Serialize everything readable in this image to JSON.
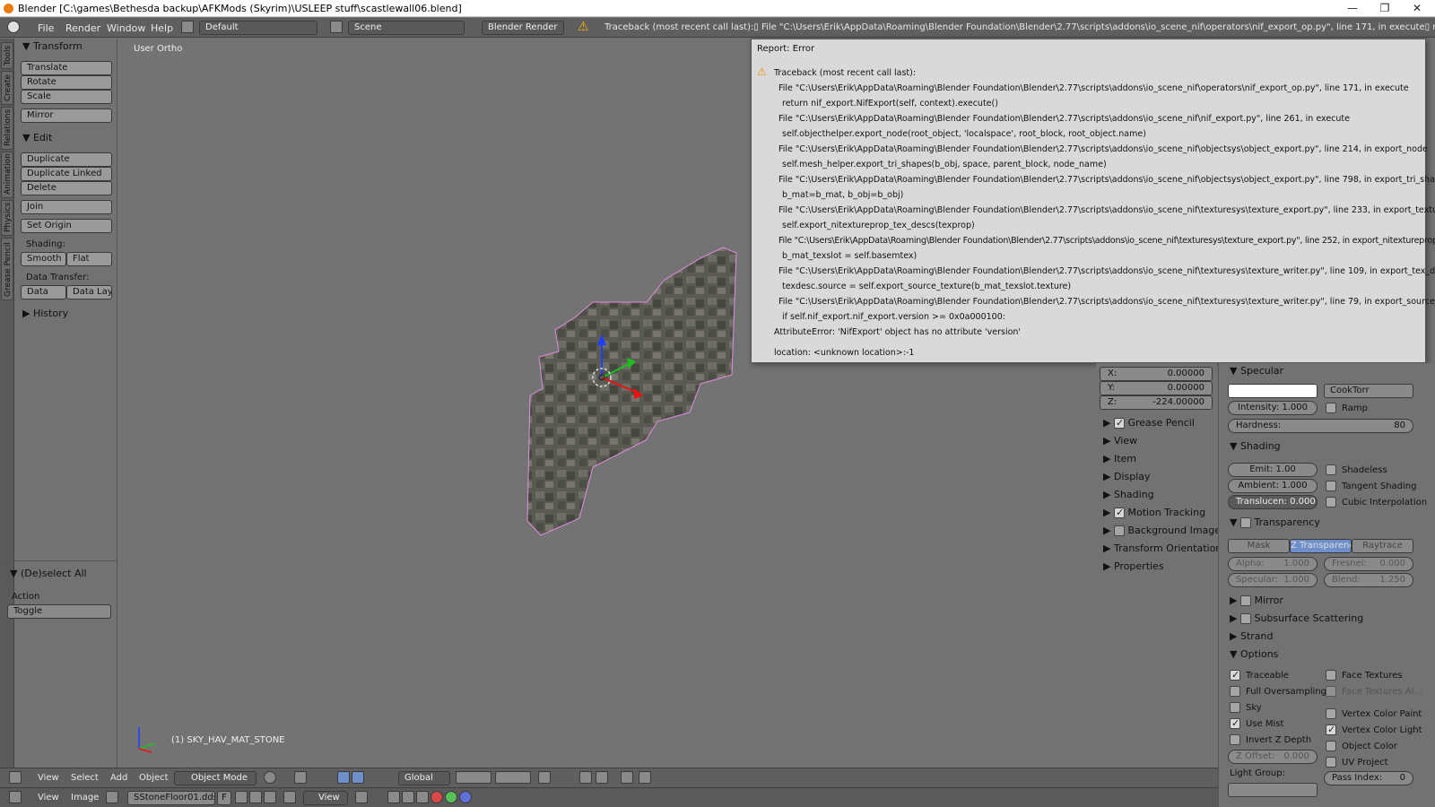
{
  "titlebar": {
    "title": "Blender [C:\\games\\Bethesda backup\\AFKMods (Skyrim)\\USLEEP stuff\\scastlewall06.blend]",
    "minimize": "—",
    "restore": "❐",
    "close": "✕"
  },
  "topbar": {
    "menus": [
      "File",
      "Render",
      "Window",
      "Help"
    ],
    "layout": "Default",
    "scene": "Scene",
    "engine": "Blender Render",
    "report": "Traceback (most recent call last):▯  File \"C:\\Users\\Erik\\AppData\\Roaming\\Blender Foundation\\Blender\\2.77\\scripts\\addons\\io_scene_nif\\operators\\nif_export_op.py\", line 171, in execute▯     return nif_export.NifExport(self, conte"
  },
  "tooltabs": [
    "Tools",
    "Create",
    "Relations",
    "Animation",
    "Physics",
    "Grease Pencil"
  ],
  "toolshelf": {
    "transform_header": "Transform",
    "translate": "Translate",
    "rotate": "Rotate",
    "scale": "Scale",
    "mirror": "Mirror",
    "edit_header": "Edit",
    "duplicate": "Duplicate",
    "duplicate_linked": "Duplicate Linked",
    "delete": "Delete",
    "join": "Join",
    "set_origin": "Set Origin",
    "shading_label": "Shading:",
    "smooth": "Smooth",
    "flat": "Flat",
    "data_transfer_label": "Data Transfer:",
    "data": "Data",
    "data_layout": "Data Layo",
    "history_header": "History",
    "deselect_header": "(De)select All",
    "action_label": "Action",
    "action_value": "Toggle"
  },
  "viewport": {
    "view_name": "User Ortho",
    "object_label": "(1) SKY_HAV_MAT_STONE"
  },
  "error_panel": {
    "title": "Report: Error",
    "lines": [
      "Traceback (most recent call last):",
      "File \"C:\\Users\\Erik\\AppData\\Roaming\\Blender Foundation\\Blender\\2.77\\scripts\\addons\\io_scene_nif\\operators\\nif_export_op.py\", line 171, in execute",
      "return nif_export.NifExport(self, context).execute()",
      "File \"C:\\Users\\Erik\\AppData\\Roaming\\Blender Foundation\\Blender\\2.77\\scripts\\addons\\io_scene_nif\\nif_export.py\", line 261, in execute",
      "self.objecthelper.export_node(root_object, 'localspace', root_block, root_object.name)",
      "File \"C:\\Users\\Erik\\AppData\\Roaming\\Blender Foundation\\Blender\\2.77\\scripts\\addons\\io_scene_nif\\objectsys\\object_export.py\", line 214, in export_node",
      "self.mesh_helper.export_tri_shapes(b_obj, space, parent_block, node_name)",
      "File \"C:\\Users\\Erik\\AppData\\Roaming\\Blender Foundation\\Blender\\2.77\\scripts\\addons\\io_scene_nif\\objectsys\\object_export.py\", line 798, in export_tri_shapes",
      "b_mat=b_mat, b_obj=b_obj)",
      "File \"C:\\Users\\Erik\\AppData\\Roaming\\Blender Foundation\\Blender\\2.77\\scripts\\addons\\io_scene_nif\\texturesys\\texture_export.py\", line 233, in export_texturing_property",
      "self.export_nitextureprop_tex_descs(texprop)",
      "File \"C:\\Users\\Erik\\AppData\\Roaming\\Blender Foundation\\Blender\\2.77\\scripts\\addons\\io_scene_nif\\texturesys\\texture_export.py\", line 252, in export_nitextureprop_tex_descs",
      "b_mat_texslot = self.basemtex)",
      "File \"C:\\Users\\Erik\\AppData\\Roaming\\Blender Foundation\\Blender\\2.77\\scripts\\addons\\io_scene_nif\\texturesys\\texture_writer.py\", line 109, in export_tex_desc",
      "texdesc.source = self.export_source_texture(b_mat_texslot.texture)",
      "File \"C:\\Users\\Erik\\AppData\\Roaming\\Blender Foundation\\Blender\\2.77\\scripts\\addons\\io_scene_nif\\texturesys\\texture_writer.py\", line 79, in export_source_texture",
      "if self.nif_export.nif_export.version >= 0x0a000100:",
      "AttributeError: 'NifExport' object has no attribute 'version'",
      "location: <unknown location>:-1"
    ]
  },
  "n_panel": {
    "x_label": "X:",
    "x": "0.00000",
    "y_label": "Y:",
    "y": "0.00000",
    "z_label": "Z:",
    "z": "-224.00000",
    "sections": [
      "Grease Pencil",
      "View",
      "Item",
      "Display",
      "Shading",
      "Motion Tracking",
      "Background Images",
      "Transform Orientations",
      "Properties"
    ]
  },
  "properties": {
    "specular": "Specular",
    "specular_shader": "CookTorr",
    "intensity": "Intensity:",
    "intensity_value": "1.000",
    "ramp": "Ramp",
    "hardness": "Hardness:",
    "hardness_value": "80",
    "shading": "Shading",
    "emit": "Emit:",
    "emit_value": "1.00",
    "shadeless": "Shadeless",
    "ambient": "Ambient:",
    "ambient_value": "1.000",
    "tangent_shading": "Tangent Shading",
    "translucency": "Translucen:",
    "translucency_value": "0.000",
    "cubic": "Cubic Interpolation",
    "transparency": "Transparency",
    "mask": "Mask",
    "ztransp": "Z Transparency",
    "raytrace": "Raytrace",
    "alpha": "Alpha:",
    "alpha_value": "1.000",
    "fresnel": "Fresnel:",
    "fresnel_value": "0.000",
    "spec": "Specular:",
    "spec_value": "1.000",
    "blend": "Blend:",
    "blend_value": "1.250",
    "mirror": "Mirror",
    "sss": "Subsurface Scattering",
    "strand": "Strand",
    "options": "Options",
    "traceable": "Traceable",
    "face_textures": "Face Textures",
    "full_oversampling": "Full Oversampling",
    "face_textures_alpha": "Face Textures Al...",
    "sky": "Sky",
    "vertex_color_paint": "Vertex Color Paint",
    "use_mist": "Use Mist",
    "vertex_color_light": "Vertex Color Light",
    "invert_z": "Invert Z Depth",
    "object_color": "Object Color",
    "z_offset": "Z Offset:",
    "z_offset_value": "0.000",
    "uv_project": "UV Project",
    "light_group": "Light Group:",
    "pass_index": "Pass Index:",
    "pass_index_value": "0"
  },
  "bottombar1": {
    "view": "View",
    "select": "Select",
    "add": "Add",
    "object": "Object",
    "mode": "Object Mode",
    "orientation": "Global"
  },
  "bottombar2": {
    "view": "View",
    "image": "Image",
    "image_name": "SStoneFloor01.dds....",
    "fake_user": "F",
    "view2": "View"
  }
}
